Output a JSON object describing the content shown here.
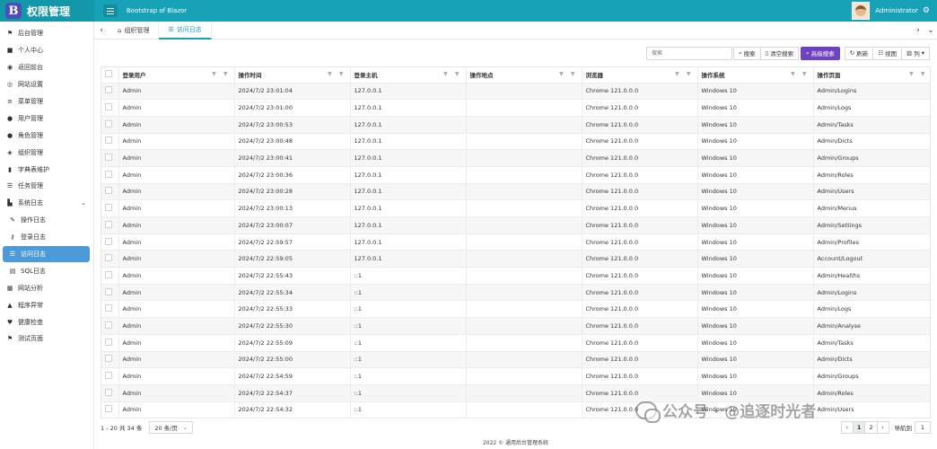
{
  "header": {
    "brand_letter": "B",
    "brand_title": "权限管理",
    "app_subtitle": "Bootstrap of Blazor",
    "username": "Administrator",
    "accent_color": "#17a2b8"
  },
  "sidebar": {
    "items": [
      {
        "label": "后台管理",
        "icon": "flag-icon"
      },
      {
        "label": "个人中心",
        "icon": "briefcase-icon"
      },
      {
        "label": "返回前台",
        "icon": "circle-icon"
      },
      {
        "label": "网站设置",
        "icon": "globe-icon"
      },
      {
        "label": "菜单管理",
        "icon": "bars-icon"
      },
      {
        "label": "用户管理",
        "icon": "user-icon"
      },
      {
        "label": "角色管理",
        "icon": "users-icon"
      },
      {
        "label": "组织管理",
        "icon": "sitemap-icon"
      },
      {
        "label": "字典表维护",
        "icon": "book-icon"
      },
      {
        "label": "任务管理",
        "icon": "tasks-icon"
      },
      {
        "label": "系统日志",
        "icon": "file-icon"
      },
      {
        "label": "操作日志",
        "icon": "edit-icon"
      },
      {
        "label": "登录日志",
        "icon": "key-icon"
      },
      {
        "label": "访问日志",
        "icon": "list-icon"
      },
      {
        "label": "SQL日志",
        "icon": "database-icon"
      },
      {
        "label": "网站分析",
        "icon": "chart-icon"
      },
      {
        "label": "程序异常",
        "icon": "warning-icon"
      },
      {
        "label": "健康检查",
        "icon": "heart-icon"
      },
      {
        "label": "测试页面",
        "icon": "flag-icon"
      }
    ]
  },
  "tabs": [
    {
      "label": "组织管理"
    },
    {
      "label": "访问日志"
    }
  ],
  "toolbar": {
    "search_placeholder": "搜索",
    "search_label": "搜索",
    "clear_label": "清空搜索",
    "advanced_label": "高级搜索",
    "refresh_label": "刷新",
    "view_label": "视图",
    "columns_label": "列"
  },
  "table": {
    "columns": [
      "登录用户",
      "操作时间",
      "登录主机",
      "操作地点",
      "浏览器",
      "操作系统",
      "操作页面"
    ],
    "rows": [
      [
        "Admin",
        "2024/7/2 23:01:04",
        "127.0.0.1",
        "",
        "Chrome 121.0.0.0",
        "Windows 10",
        "Admin/Logins"
      ],
      [
        "Admin",
        "2024/7/2 23:01:00",
        "127.0.0.1",
        "",
        "Chrome 121.0.0.0",
        "Windows 10",
        "Admin/Logs"
      ],
      [
        "Admin",
        "2024/7/2 23:00:53",
        "127.0.0.1",
        "",
        "Chrome 121.0.0.0",
        "Windows 10",
        "Admin/Tasks"
      ],
      [
        "Admin",
        "2024/7/2 23:00:48",
        "127.0.0.1",
        "",
        "Chrome 121.0.0.0",
        "Windows 10",
        "Admin/Dicts"
      ],
      [
        "Admin",
        "2024/7/2 23:00:41",
        "127.0.0.1",
        "",
        "Chrome 121.0.0.0",
        "Windows 10",
        "Admin/Groups"
      ],
      [
        "Admin",
        "2024/7/2 23:00:36",
        "127.0.0.1",
        "",
        "Chrome 121.0.0.0",
        "Windows 10",
        "Admin/Roles"
      ],
      [
        "Admin",
        "2024/7/2 23:00:28",
        "127.0.0.1",
        "",
        "Chrome 121.0.0.0",
        "Windows 10",
        "Admin/Users"
      ],
      [
        "Admin",
        "2024/7/2 23:00:13",
        "127.0.0.1",
        "",
        "Chrome 121.0.0.0",
        "Windows 10",
        "Admin/Menus"
      ],
      [
        "Admin",
        "2024/7/2 23:00:07",
        "127.0.0.1",
        "",
        "Chrome 121.0.0.0",
        "Windows 10",
        "Admin/Settings"
      ],
      [
        "Admin",
        "2024/7/2 22:59:57",
        "127.0.0.1",
        "",
        "Chrome 121.0.0.0",
        "Windows 10",
        "Admin/Profiles"
      ],
      [
        "Admin",
        "2024/7/2 22:59:05",
        "127.0.0.1",
        "",
        "Chrome 121.0.0.0",
        "Windows 10",
        "Account/Logout"
      ],
      [
        "Admin",
        "2024/7/2 22:55:43",
        "::1",
        "",
        "Chrome 121.0.0.0",
        "Windows 10",
        "Admin/Healths"
      ],
      [
        "Admin",
        "2024/7/2 22:55:34",
        "::1",
        "",
        "Chrome 121.0.0.0",
        "Windows 10",
        "Admin/Logins"
      ],
      [
        "Admin",
        "2024/7/2 22:55:33",
        "::1",
        "",
        "Chrome 121.0.0.0",
        "Windows 10",
        "Admin/Logs"
      ],
      [
        "Admin",
        "2024/7/2 22:55:30",
        "::1",
        "",
        "Chrome 121.0.0.0",
        "Windows 10",
        "Admin/Analyse"
      ],
      [
        "Admin",
        "2024/7/2 22:55:09",
        "::1",
        "",
        "Chrome 121.0.0.0",
        "Windows 10",
        "Admin/Tasks"
      ],
      [
        "Admin",
        "2024/7/2 22:55:00",
        "::1",
        "",
        "Chrome 121.0.0.0",
        "Windows 10",
        "Admin/Dicts"
      ],
      [
        "Admin",
        "2024/7/2 22:54:59",
        "::1",
        "",
        "Chrome 121.0.0.0",
        "Windows 10",
        "Admin/Groups"
      ],
      [
        "Admin",
        "2024/7/2 22:54:37",
        "::1",
        "",
        "Chrome 121.0.0.0",
        "Windows 10",
        "Admin/Roles"
      ],
      [
        "Admin",
        "2024/7/2 22:54:32",
        "::1",
        "",
        "Chrome 121.0.0.0",
        "Windows 10",
        "Admin/Users"
      ]
    ]
  },
  "pagination": {
    "info": "1 - 20 共 34 条",
    "page_size": "20 条/页",
    "prev": "‹",
    "pages": [
      "1",
      "2"
    ],
    "next": "›",
    "goto_label": "导航到",
    "goto_value": "1"
  },
  "footer": {
    "text": "2022 © 通用后台管理系统"
  },
  "watermark": {
    "text": "公众号 · @追逐时光者"
  }
}
